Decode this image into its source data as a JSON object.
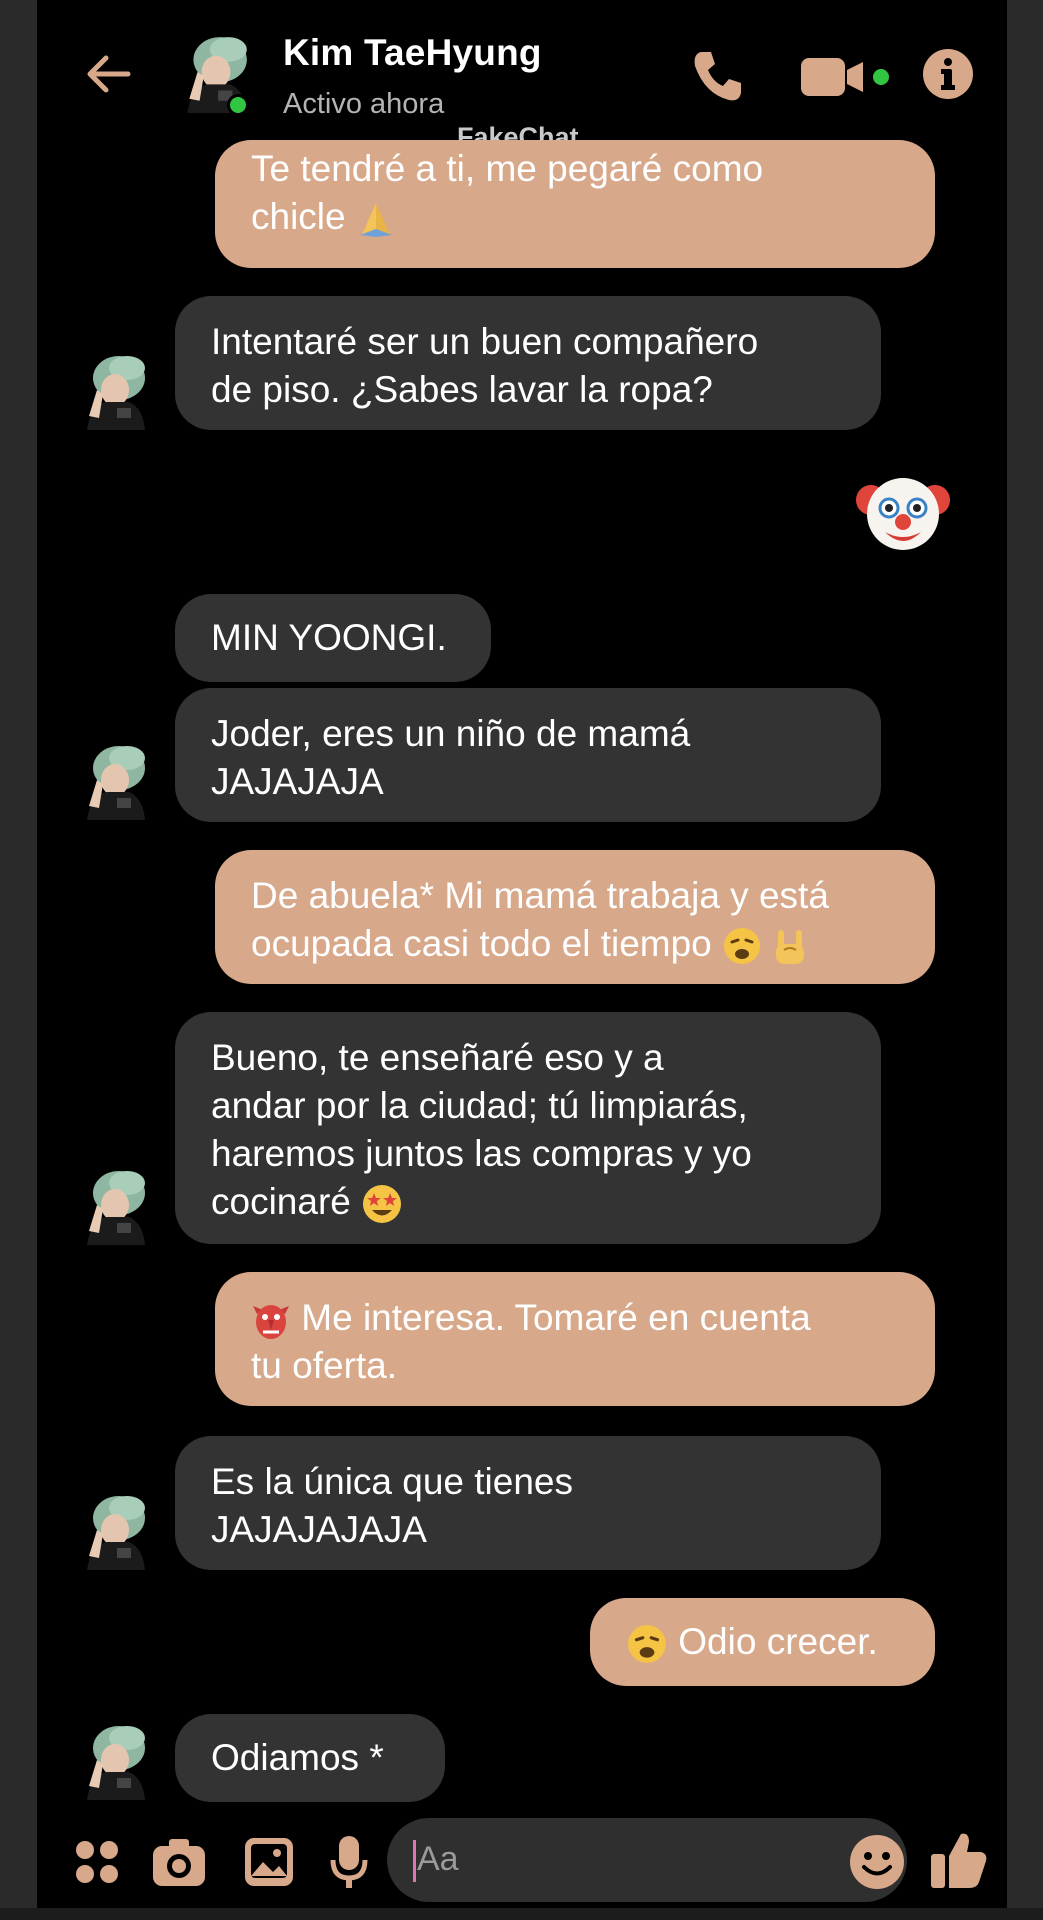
{
  "header": {
    "contact_name": "Kim TaeHyung",
    "status": "Activo ahora",
    "watermark": "FakeChat",
    "icons": [
      "back-arrow-icon",
      "phone-icon",
      "video-camera-icon",
      "info-icon"
    ]
  },
  "messages": [
    {
      "dir": "out",
      "text": "Te tendré a ti, me pegaré como chicle",
      "emoji": "folded-hands"
    },
    {
      "dir": "in",
      "text": "Intentaré ser un buen compañero de piso. ¿Sabes lavar la ropa?"
    },
    {
      "dir": "out",
      "emoji": "clown-face"
    },
    {
      "dir": "in",
      "text": "MIN YOONGI."
    },
    {
      "dir": "in",
      "text": "Joder, eres un niño de mamá JAJAJAJA"
    },
    {
      "dir": "out",
      "text": "De abuela* Mi mamá trabaja y está ocupada casi todo el tiempo",
      "emoji": [
        "weary-face",
        "sign-of-the-horns"
      ]
    },
    {
      "dir": "in",
      "text": "Bueno, te enseñaré eso y a andar por la ciudad; tú limpiarás, haremos juntos las compras y yo cocinaré",
      "emoji": "star-struck"
    },
    {
      "dir": "out",
      "text": "Me interesa. Tomaré en cuenta tu oferta.",
      "emoji": "goblin"
    },
    {
      "dir": "in",
      "text": "Es la única que tienes JAJAJAJAJA"
    },
    {
      "dir": "out",
      "text": "Odio crecer.",
      "emoji": "weary-face"
    },
    {
      "dir": "in",
      "text": "Odiamos *"
    }
  ],
  "m": {
    "m1_l1": "Te tendré a ti, me pegaré como",
    "m1_l2": "chicle",
    "m2_l1": "Intentaré ser un buen compañero",
    "m2_l2": "de piso. ¿Sabes lavar la ropa?",
    "m4": "MIN YOONGI.",
    "m5_l1": "Joder, eres un niño de mamá",
    "m5_l2": "JAJAJAJA",
    "m6_l1": "De abuela* Mi mamá trabaja y está",
    "m6_l2": "ocupada casi todo el tiempo",
    "m7_l1": "Bueno, te enseñaré eso y a",
    "m7_l2": "andar por la ciudad; tú limpiarás,",
    "m7_l3": "haremos juntos las compras y yo",
    "m7_l4": "cocinaré",
    "m8_l1": "Me interesa. Tomaré en cuenta",
    "m8_l2": "tu oferta.",
    "m9_l1": "Es la única que tienes",
    "m9_l2": "JAJAJAJAJA",
    "m10": "Odio crecer.",
    "m11": "Odiamos *"
  },
  "composer": {
    "placeholder": "Aa",
    "icons": [
      "apps-grid-icon",
      "camera-icon",
      "gallery-icon",
      "microphone-icon",
      "emoji-icon",
      "thumbs-up-icon"
    ]
  },
  "colors": {
    "outgoing_bubble": "#d8a88a",
    "incoming_bubble": "#333333",
    "background": "#000000",
    "online": "#31c542"
  }
}
